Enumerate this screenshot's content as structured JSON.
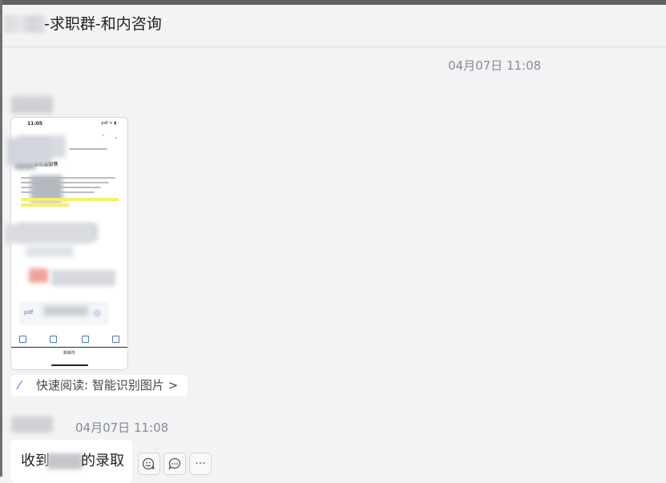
{
  "header": {
    "title": "-求职群-和内咨询"
  },
  "messages": [
    {
      "timestamp": "04月07日 11:08"
    },
    {
      "image": {
        "phone_time": "11:05",
        "phone_status": "pdf ᯤ ▮",
        "doc_title": "录用通知书",
        "attachment_type": "pdf",
        "caption": "新邮件"
      },
      "quick_read_label": "快速阅读: 智能识别图片 >"
    },
    {
      "timestamp": "04月07日 11:08",
      "text_before": "收到",
      "text_after": "的录取"
    }
  ],
  "actions": {
    "emoji_icon": "add-reaction-icon",
    "reply_icon": "reply-bubble-icon",
    "more_label": "···"
  }
}
